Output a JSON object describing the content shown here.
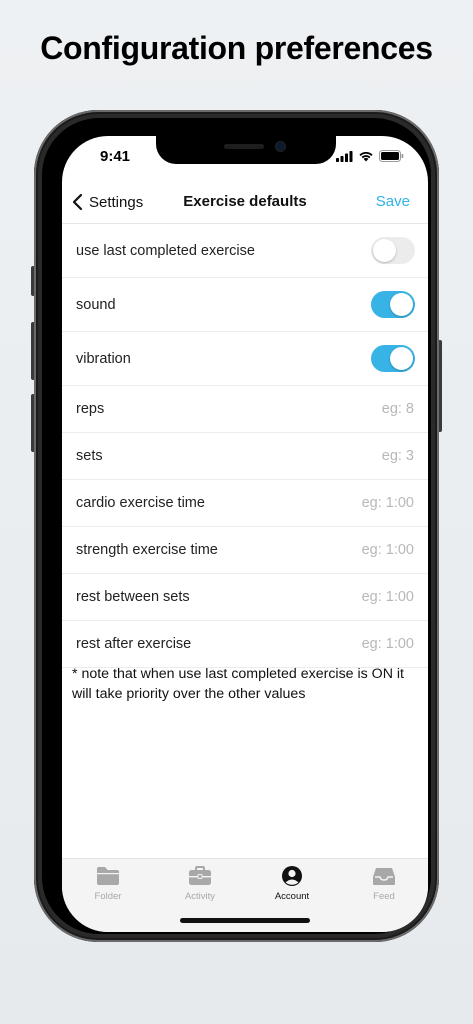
{
  "headline": "Configuration preferences",
  "status": {
    "time": "9:41"
  },
  "navbar": {
    "back_label": "Settings",
    "title": "Exercise defaults",
    "save_label": "Save"
  },
  "toggles": [
    {
      "label": "use last completed exercise",
      "on": false
    },
    {
      "label": "sound",
      "on": true
    },
    {
      "label": "vibration",
      "on": true
    }
  ],
  "fields": [
    {
      "label": "reps",
      "placeholder": "eg: 8"
    },
    {
      "label": "sets",
      "placeholder": "eg: 3"
    },
    {
      "label": "cardio exercise time",
      "placeholder": "eg: 1:00"
    },
    {
      "label": "strength exercise time",
      "placeholder": "eg: 1:00"
    },
    {
      "label": "rest between sets",
      "placeholder": "eg: 1:00"
    },
    {
      "label": "rest after exercise",
      "placeholder": "eg: 1:00"
    }
  ],
  "note": "* note that when use last completed exercise is ON it will take priority over the other values",
  "tabs": [
    {
      "label": "Folder",
      "icon": "folder-icon",
      "active": false
    },
    {
      "label": "Activity",
      "icon": "briefcase-icon",
      "active": false
    },
    {
      "label": "Account",
      "icon": "account-icon",
      "active": true
    },
    {
      "label": "Feed",
      "icon": "inbox-icon",
      "active": false
    }
  ],
  "colors": {
    "accent": "#38b3e6",
    "save": "#2fb3e8",
    "toggle_off": "#ececec"
  }
}
